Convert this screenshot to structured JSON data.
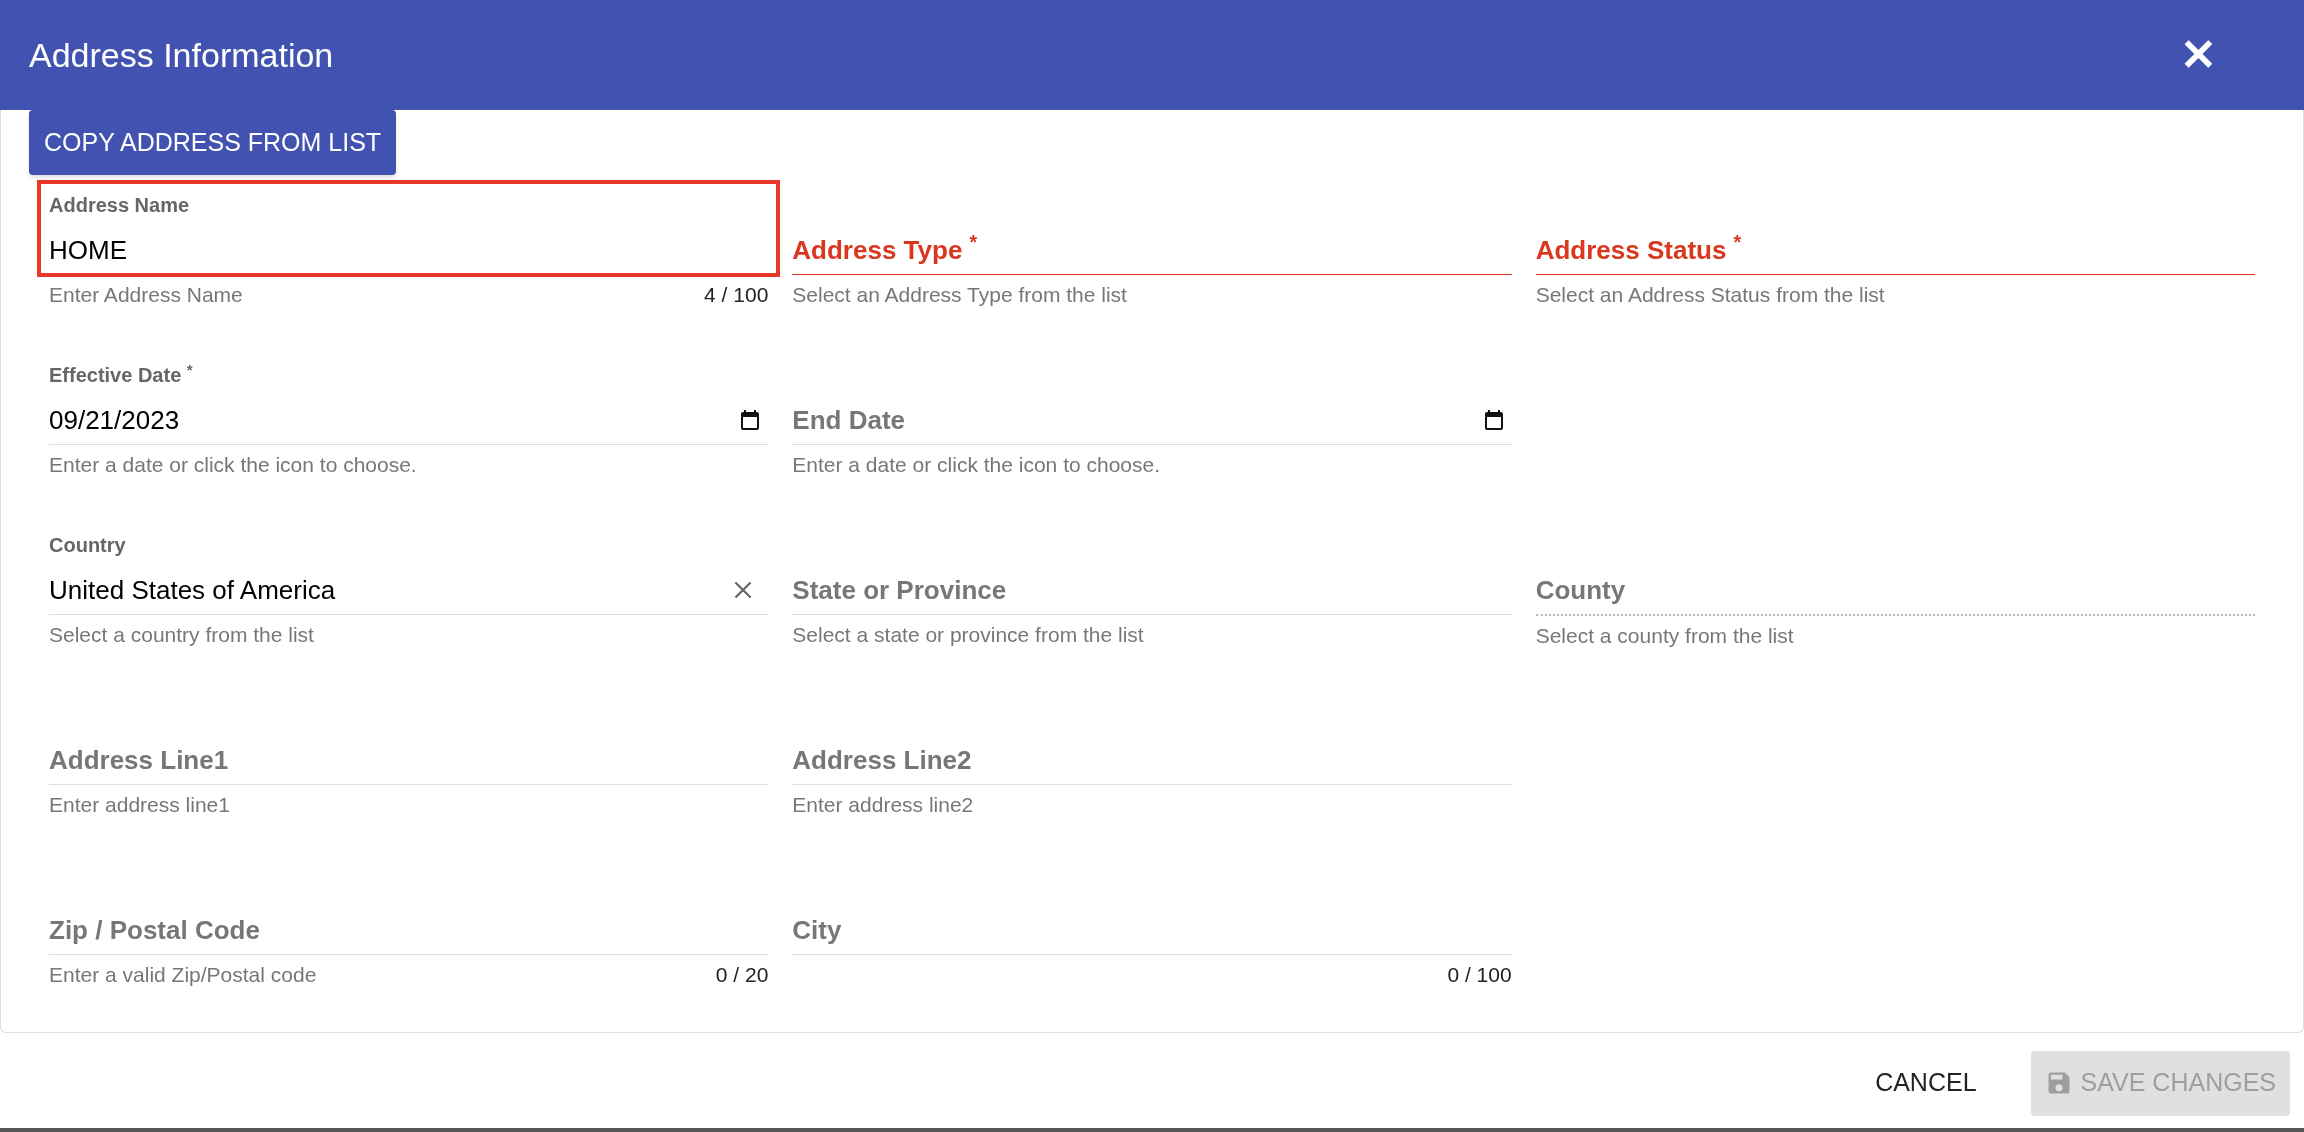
{
  "dialog": {
    "title": "Address Information",
    "close_icon": "✕"
  },
  "copy_button": "COPY ADDRESS FROM LIST",
  "rows": [
    [
      {
        "kind": "text",
        "label": "Address Name",
        "value": "HOME",
        "helper": "Enter Address Name",
        "counter": "4 / 100",
        "error": false,
        "highlighted": true,
        "disabled": false
      },
      {
        "kind": "select",
        "label": "Address Type $^{*}$",
        "helper": "Select an Address Type from the list",
        "error": true,
        "highlighted": false,
        "disabled": false
      },
      {
        "kind": "select",
        "label": "Address Status $^{*}$",
        "helper": "Select an Address Status from the list",
        "error": true,
        "highlighted": false,
        "disabled": false
      }
    ],
    [
      {
        "kind": "date",
        "label": "Effective Date $^{*}$",
        "value": "09/21/2023",
        "helper": "Enter a date or click the icon to choose.",
        "error": false,
        "highlighted": false,
        "disabled": false
      },
      {
        "kind": "date",
        "label": "End Date",
        "helper": "Enter a date or click the icon to choose.",
        "error": false,
        "highlighted": false,
        "disabled": false
      }
    ],
    [
      {
        "kind": "select",
        "label": "Country",
        "value": "United States of America",
        "clearable": true,
        "helper": "Select a country from the list",
        "error": false,
        "highlighted": false,
        "disabled": false
      },
      {
        "kind": "select",
        "label": "State or Province",
        "helper": "Select a state or province from the list",
        "error": false,
        "highlighted": false,
        "disabled": false
      },
      {
        "kind": "select",
        "label": "County",
        "helper": "Select a county from the list",
        "error": false,
        "highlighted": false,
        "disabled": true
      }
    ],
    [
      {
        "kind": "text",
        "label": "Address Line1",
        "helper": "Enter address line1",
        "error": false,
        "highlighted": false,
        "disabled": false
      },
      {
        "kind": "text",
        "label": "Address Line2",
        "helper": "Enter address line2",
        "error": false,
        "highlighted": false,
        "disabled": false
      }
    ],
    [
      {
        "kind": "text",
        "label": "Zip / Postal Code",
        "helper": "Enter a valid Zip/Postal code",
        "counter": "0 / 20",
        "error": false,
        "highlighted": false,
        "disabled": false
      },
      {
        "kind": "text",
        "label": "City",
        "counter": "0 / 100",
        "error": false,
        "highlighted": false,
        "disabled": false
      }
    ]
  ],
  "footer": {
    "cancel": "CANCEL",
    "save": {
      "label": "SAVE CHANGES",
      "disabled": true
    }
  }
}
